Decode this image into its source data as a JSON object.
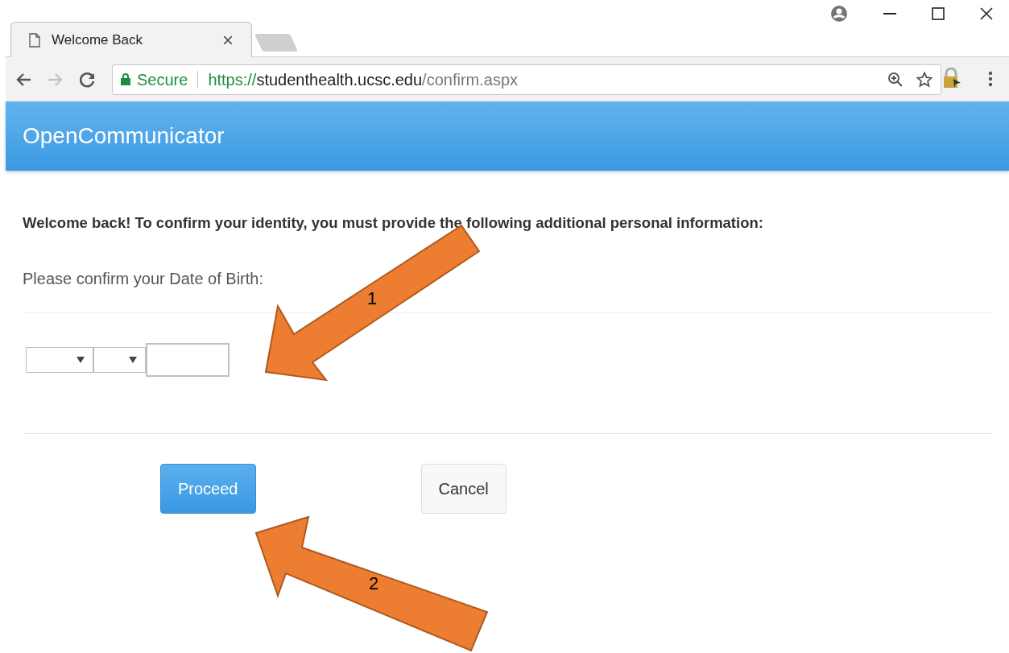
{
  "browser": {
    "tabs": [
      {
        "title": "Welcome Back",
        "close": "×",
        "selected": true
      }
    ],
    "address": {
      "security": "Secure",
      "scheme": "https://",
      "host": "studenthealth.ucsc.edu",
      "path": "/confirm.aspx"
    }
  },
  "app": {
    "title": "OpenCommunicator"
  },
  "form": {
    "heading": "Welcome back! To confirm your identity, you must provide the following additional personal information:",
    "prompt": "Please confirm your Date of Birth:",
    "fields": [
      {
        "kind": "select"
      },
      {
        "kind": "select"
      },
      {
        "kind": "text"
      }
    ],
    "buttons": [
      {
        "label": "Proceed",
        "kind": "primary"
      },
      {
        "label": "Cancel",
        "kind": "default"
      }
    ]
  },
  "annotations": [
    {
      "label": "1"
    },
    {
      "label": "2"
    }
  ]
}
